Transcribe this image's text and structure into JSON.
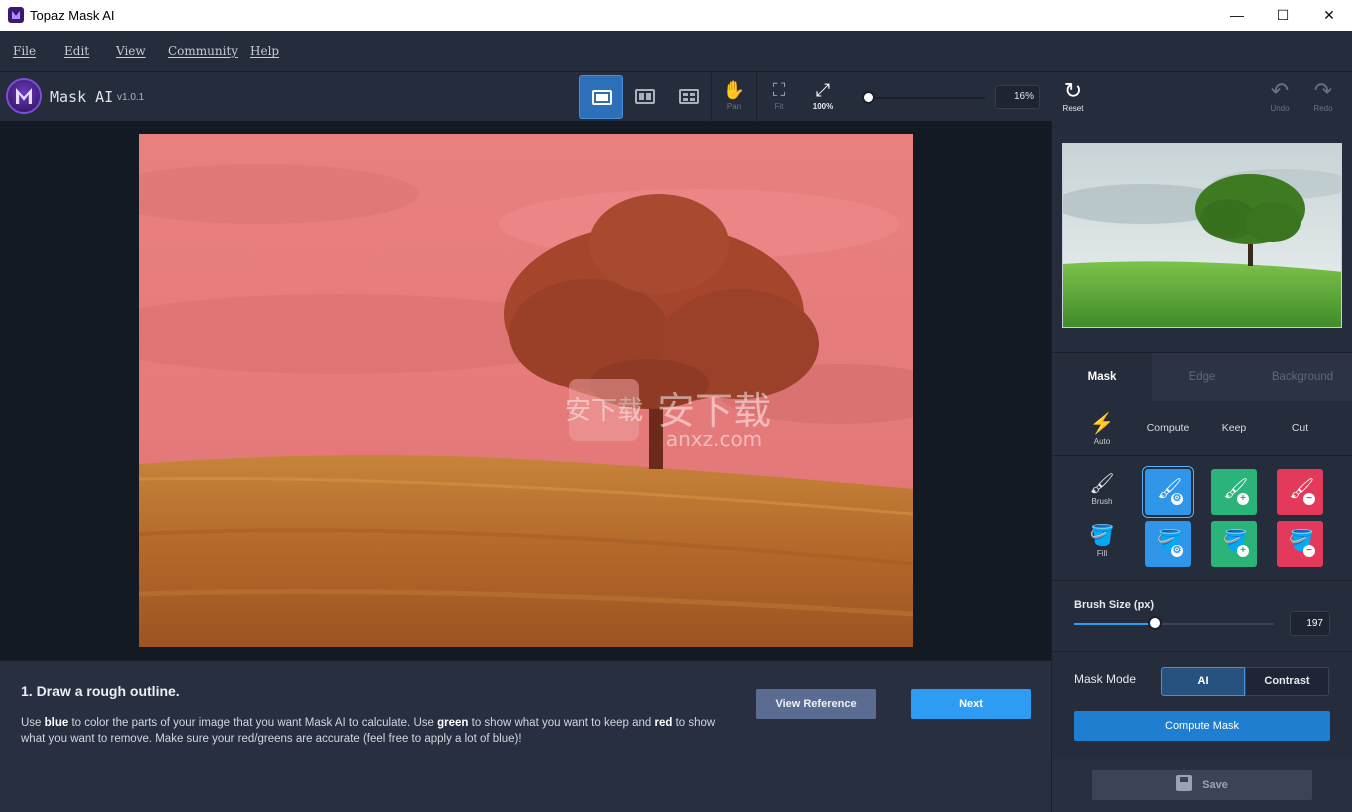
{
  "window": {
    "title": "Topaz Mask AI",
    "minimize": "—",
    "maximize": "☐",
    "close": "✕"
  },
  "menu": [
    "File",
    "Edit",
    "View",
    "Community",
    "Help"
  ],
  "brand": {
    "name": "Mask AI",
    "version": "v1.0.1"
  },
  "toolbar": {
    "pan": "Pan",
    "fit": "Fit",
    "full": "100%",
    "zoom_value": "16%",
    "zoom_level": 0.16,
    "reset": "Reset",
    "undo": "Undo",
    "redo": "Redo"
  },
  "icons": {
    "pan": "✋",
    "fit": "⛶",
    "full": "⤢",
    "reset": "↻",
    "undo": "↶",
    "redo": "↷",
    "auto": "⚡",
    "brush": "🖌",
    "fill": "🪣",
    "compute_brush": "🖌",
    "compute_fill": "🪣",
    "keep_brush": "🖌",
    "keep_fill": "🪣",
    "cut_brush": "🖌",
    "cut_fill": "🪣",
    "gear": "⚙",
    "plus": "+",
    "minus": "−"
  },
  "watermark": {
    "text": "安下载",
    "subtext": "anxz.com"
  },
  "instructions": {
    "title": "1. Draw a rough outline.",
    "body_1": "Use ",
    "blue": "blue",
    "body_2": " to color the parts of your image that you want Mask AI to calculate. Use ",
    "green": "green",
    "body_3": " to show what you want to keep and ",
    "red": "red",
    "body_4": " to show what you want to remove. Make sure your red/greens are accurate (feel free to apply a lot of blue)!",
    "view_reference": "View Reference",
    "next": "Next"
  },
  "sidebar": {
    "tabs": [
      "Mask",
      "Edge",
      "Background"
    ],
    "auto_label": "Auto",
    "columns": [
      "Compute",
      "Keep",
      "Cut"
    ],
    "brush_label": "Brush",
    "fill_label": "Fill",
    "brush_size_label": "Brush Size (px)",
    "brush_size_value": "197",
    "mask_mode_label": "Mask Mode",
    "mask_mode_options": [
      "AI",
      "Contrast"
    ],
    "compute_mask": "Compute Mask",
    "save": "Save"
  },
  "colors": {
    "compute": "#2f96e9",
    "keep": "#2bb47a",
    "cut": "#e33a5c",
    "accent": "#2e9cf3",
    "overlay": "#ff7a7a"
  }
}
